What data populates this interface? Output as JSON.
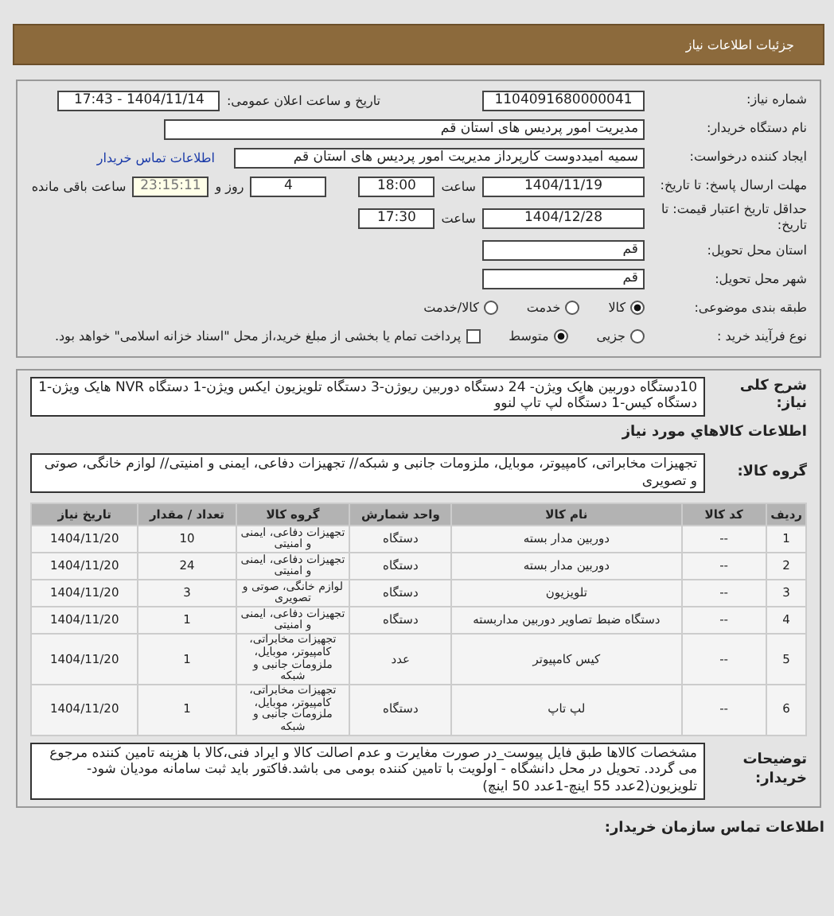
{
  "header": {
    "title": "جزئیات اطلاعات نیاز"
  },
  "need_number": {
    "label": "شماره نیاز:",
    "value": "1104091680000041"
  },
  "announce": {
    "label": "تاریخ و ساعت اعلان عمومی:",
    "value": "1404/11/14 - 17:43"
  },
  "buyer": {
    "label": "نام دستگاه خریدار:",
    "value": "مدیریت امور پردیس های استان قم"
  },
  "requester": {
    "label": "ایجاد کننده درخواست:",
    "value": "سمیه امیددوست کارپرداز مدیریت امور پردیس های استان قم",
    "link": "اطلاعات تماس خریدار"
  },
  "deadline": {
    "label": "مهلت ارسال پاسخ: تا تاریخ:",
    "date": "1404/11/19",
    "time_label": "ساعت",
    "time": "18:00",
    "days": "4",
    "days_label": "روز و",
    "remaining": "23:15:11",
    "remaining_label": "ساعت باقی مانده"
  },
  "validity": {
    "label": "حداقل تاریخ اعتبار قیمت: تا تاریخ:",
    "date": "1404/12/28",
    "time_label": "ساعت",
    "time": "17:30"
  },
  "province": {
    "label": "استان محل تحویل:",
    "value": "قم"
  },
  "city": {
    "label": "شهر محل تحویل:",
    "value": "قم"
  },
  "category": {
    "label": "طبقه بندی موضوعی:",
    "options": [
      {
        "label": "کالا",
        "selected": true
      },
      {
        "label": "خدمت",
        "selected": false
      },
      {
        "label": "کالا/خدمت",
        "selected": false
      }
    ]
  },
  "purchase": {
    "label": "نوع فرآیند خرید :",
    "options": [
      {
        "kind": "radio",
        "label": "جزیی",
        "selected": false
      },
      {
        "kind": "radio",
        "label": "متوسط",
        "selected": true
      },
      {
        "kind": "checkbox",
        "label": "پرداخت تمام یا بخشی از مبلغ خرید،از محل \"اسناد خزانه اسلامی\" خواهد بود.",
        "checked": false
      }
    ]
  },
  "summary": {
    "label": "شرح کلی نیاز:",
    "value": "10دستگاه دوربین هایک ویژن- 24 دستگاه دوربین ریوژن-3 دستگاه تلویزیون ایکس ویژن-1 دستگاه NVR هایک ویژن-1 دستگاه کیس-1 دستگاه لپ تاپ لنوو"
  },
  "goods_title": "اطلاعات کالاهاي مورد نیاز",
  "group": {
    "label": "گروه کالا:",
    "value": "تجهیزات مخابراتی، کامپیوتر، موبایل، ملزومات جانبی و شبکه// تجهیزات دفاعی، ایمنی و امنیتی// لوازم خانگی، صوتی و تصویری"
  },
  "table": {
    "columns": [
      "ردیف",
      "کد کالا",
      "نام کالا",
      "واحد شمارش",
      "گروه کالا",
      "تعداد / مقدار",
      "تاریخ نیاز"
    ],
    "rows": [
      [
        "1",
        "--",
        "دوربین مدار بسته",
        "دستگاه",
        "تجهیزات دفاعی، ایمنی و امنیتی",
        "10",
        "1404/11/20"
      ],
      [
        "2",
        "--",
        "دوربین مدار بسته",
        "دستگاه",
        "تجهیزات دفاعی، ایمنی و امنیتی",
        "24",
        "1404/11/20"
      ],
      [
        "3",
        "--",
        "تلویزیون",
        "دستگاه",
        "لوازم خانگی، صوتی و تصویری",
        "3",
        "1404/11/20"
      ],
      [
        "4",
        "--",
        "دستگاه ضبط تصاویر دوربین مداربسته",
        "دستگاه",
        "تجهیزات دفاعی، ایمنی و امنیتی",
        "1",
        "1404/11/20"
      ],
      [
        "5",
        "--",
        "کیس کامپیوتر",
        "عدد",
        "تجهیزات مخابراتی، کامپیوتر، موبایل، ملزومات جانبی و شبکه",
        "1",
        "1404/11/20"
      ],
      [
        "6",
        "--",
        "لپ تاپ",
        "دستگاه",
        "تجهیزات مخابراتی، کامپیوتر، موبایل، ملزومات جانبی و شبکه",
        "1",
        "1404/11/20"
      ]
    ]
  },
  "notes": {
    "label": "توضیحات خریدار:",
    "value": "مشخصات کالاها طبق فایل پیوست_در صورت مغایرت و عدم اصالت کالا و ایراد فنی،کالا با هزینه تامین کننده مرجوع می گردد. تحویل در محل دانشگاه - اولویت با تامین کننده بومی می باشد.فاکتور باید ثبت سامانه مودیان شود- تلویزیون(2عدد 55 اینچ-1عدد 50 اینچ)"
  },
  "contact_title": "اطلاعات تماس سازمان خریدار:"
}
